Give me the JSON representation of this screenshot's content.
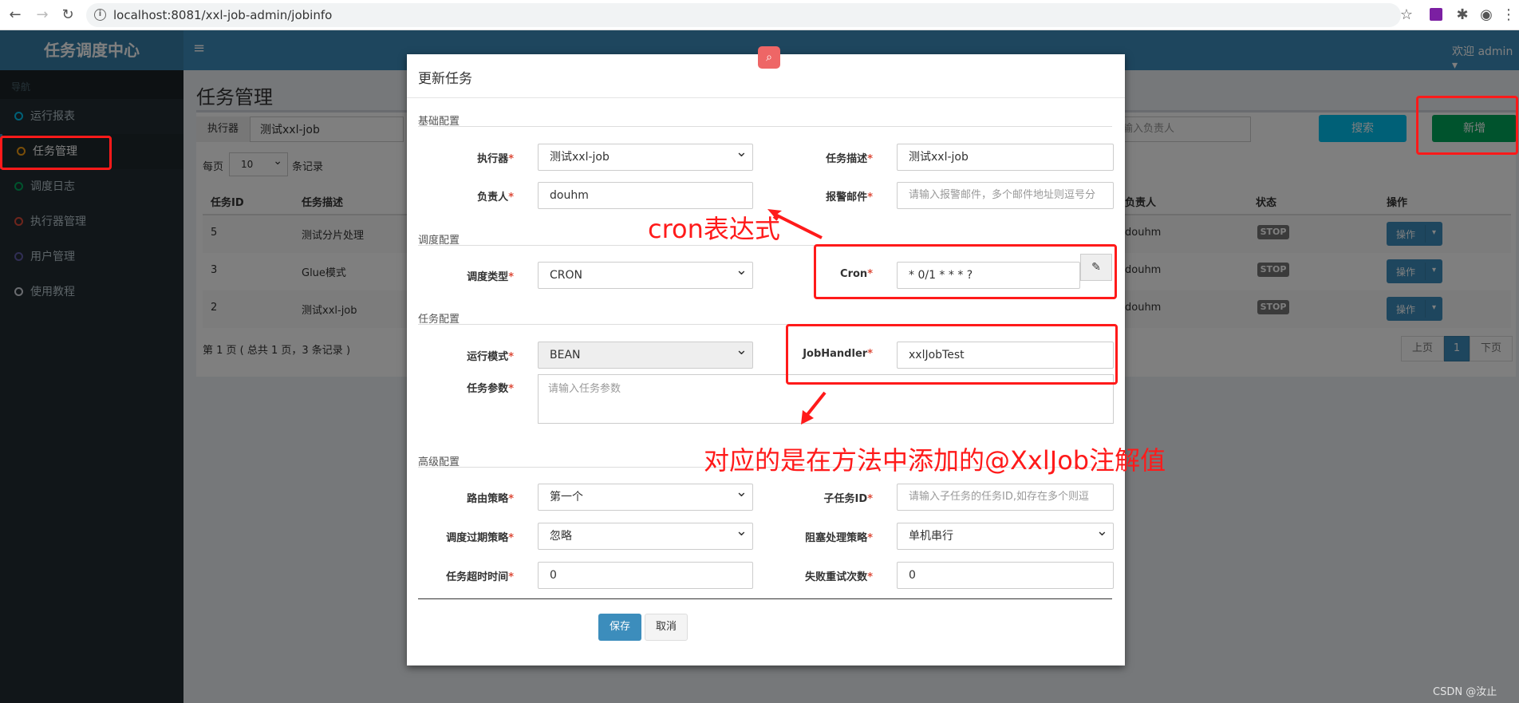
{
  "browser": {
    "url": "localhost:8081/xxl-job-admin/jobinfo"
  },
  "header": {
    "logo": "任务调度中心",
    "welcome": "欢迎 admin"
  },
  "sidebar": {
    "header": "导航",
    "items": [
      {
        "label": "运行报表",
        "color": "#00c0ef"
      },
      {
        "label": "任务管理",
        "color": "#f39c12"
      },
      {
        "label": "调度日志",
        "color": "#00a65a"
      },
      {
        "label": "执行器管理",
        "color": "#dd4b39"
      },
      {
        "label": "用户管理",
        "color": "#605ca8"
      },
      {
        "label": "使用教程",
        "color": "#d2d6de"
      }
    ]
  },
  "page": {
    "title": "任务管理",
    "executor_label": "执行器",
    "executor_value": "测试xxl-job",
    "author_placeholder": "输入负责人",
    "search_btn": "搜索",
    "add_btn": "新增",
    "perpage_label": "每页",
    "perpage_value": "10",
    "perpage_suffix": "条记录",
    "columns": {
      "id": "任务ID",
      "desc": "任务描述",
      "author": "负责人",
      "status": "状态",
      "ops": "操作"
    },
    "rows": [
      {
        "id": "5",
        "desc": "测试分片处理",
        "author": "douhm",
        "status": "STOP",
        "op": "操作"
      },
      {
        "id": "3",
        "desc": "Glue模式",
        "author": "douhm",
        "status": "STOP",
        "op": "操作"
      },
      {
        "id": "2",
        "desc": "测试xxl-job",
        "author": "douhm",
        "status": "STOP",
        "op": "操作"
      }
    ],
    "page_info": "第 1 页 ( 总共 1 页，3 条记录 )",
    "pager": {
      "prev": "上页",
      "current": "1",
      "next": "下页"
    }
  },
  "modal": {
    "title": "更新任务",
    "sections": {
      "basic": "基础配置",
      "schedule": "调度配置",
      "task": "任务配置",
      "advanced": "高级配置"
    },
    "fields": {
      "executor": {
        "label": "执行器",
        "value": "测试xxl-job"
      },
      "job_desc": {
        "label": "任务描述",
        "value": "测试xxl-job"
      },
      "author": {
        "label": "负责人",
        "value": "douhm"
      },
      "alarm_email": {
        "label": "报警邮件",
        "placeholder": "请输入报警邮件，多个邮件地址则逗号分"
      },
      "schedule_type": {
        "label": "调度类型",
        "value": "CRON"
      },
      "cron": {
        "label": "Cron",
        "value": "* 0/1 * * * ?"
      },
      "run_mode": {
        "label": "运行模式",
        "value": "BEAN"
      },
      "job_handler": {
        "label": "JobHandler",
        "value": "xxlJobTest"
      },
      "job_param": {
        "label": "任务参数",
        "placeholder": "请输入任务参数"
      },
      "route_strategy": {
        "label": "路由策略",
        "value": "第一个"
      },
      "child_job": {
        "label": "子任务ID",
        "placeholder": "请输入子任务的任务ID,如存在多个则逗"
      },
      "misfire_strategy": {
        "label": "调度过期策略",
        "value": "忽略"
      },
      "block_strategy": {
        "label": "阻塞处理策略",
        "value": "单机串行"
      },
      "timeout": {
        "label": "任务超时时间",
        "value": "0"
      },
      "fail_retry": {
        "label": "失败重试次数",
        "value": "0"
      }
    },
    "save_btn": "保存",
    "cancel_btn": "取消"
  },
  "annotations": {
    "cron_note": "cron表达式",
    "handler_note": "对应的是在方法中添加的@XxlJob注解值",
    "color": "#ff1a1a"
  },
  "watermark": "CSDN @汝止"
}
